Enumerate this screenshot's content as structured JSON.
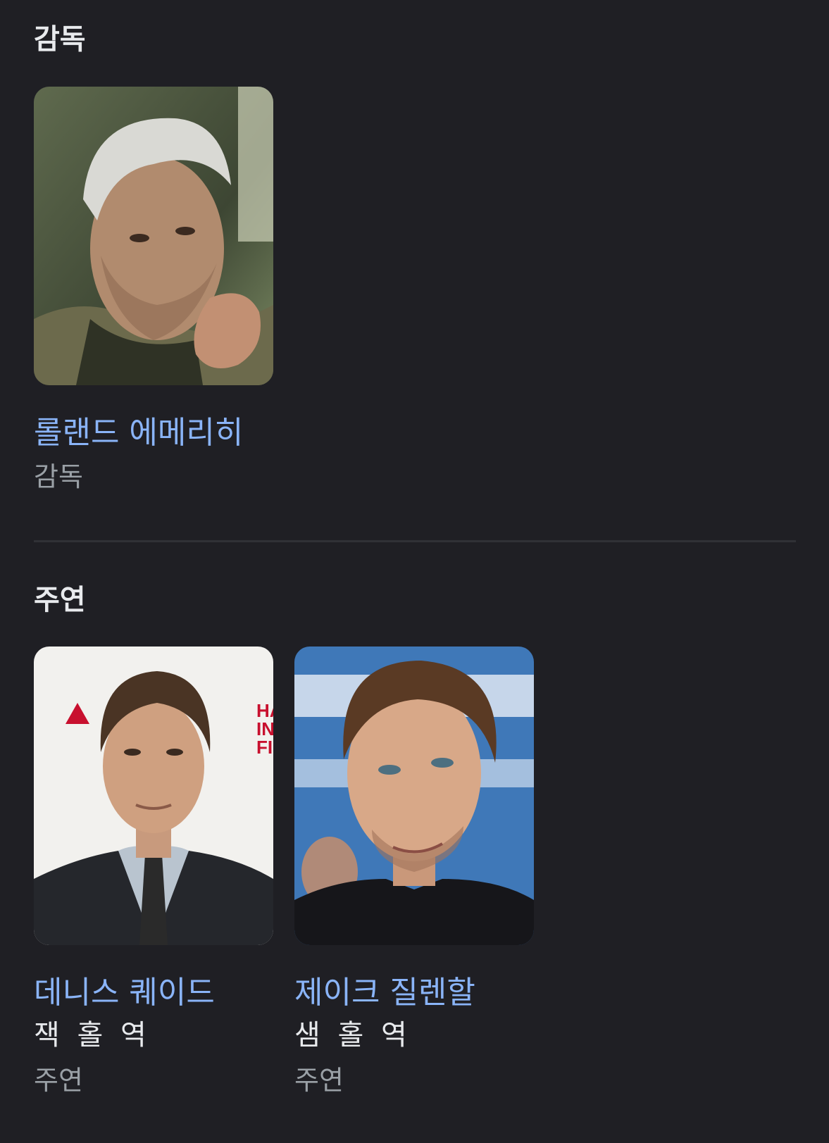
{
  "director_section": {
    "title": "감독",
    "people": [
      {
        "name": "롤랜드 에메리히",
        "kind": "감독"
      }
    ]
  },
  "cast_section": {
    "title": "주연",
    "people": [
      {
        "name": "데니스 퀘이드",
        "role": "잭 홀 역",
        "kind": "주연"
      },
      {
        "name": "제이크 질렌할",
        "role": "샘 홀 역",
        "kind": "주연"
      }
    ]
  }
}
